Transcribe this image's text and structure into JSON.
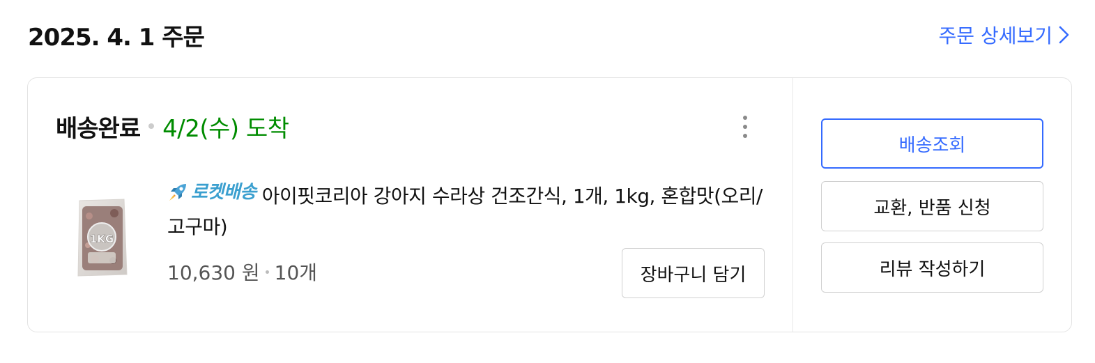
{
  "order": {
    "date_title": "2025. 4. 1 주문",
    "detail_link": "주문 상세보기"
  },
  "delivery": {
    "status": "배송완료",
    "arrival": "4/2(수) 도착"
  },
  "product": {
    "badge": "로켓배송",
    "name": "아이핏코리아 강아지 수라상 건조간식, 1개, 1kg, 혼합맛(오리/고구마)",
    "price": "10,630 원",
    "quantity": "10개",
    "thumbnail_text": "1KG"
  },
  "actions": {
    "add_to_cart": "장바구니 담기",
    "track_shipping": "배송조회",
    "exchange_return": "교환, 반품 신청",
    "write_review": "리뷰 작성하기"
  },
  "colors": {
    "accent": "#346aff",
    "status_green": "#008c00",
    "rocket": "#3a9fcf"
  },
  "icons": {
    "detail": "chevron-right-icon",
    "more": "more-vertical-icon",
    "badge": "rocket-icon"
  }
}
